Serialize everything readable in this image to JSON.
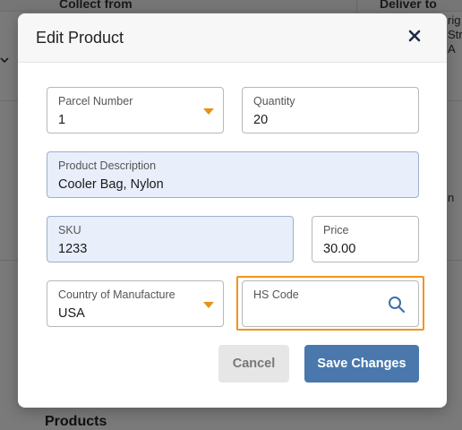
{
  "background": {
    "column_left": "Collect from",
    "column_right": "Deliver to",
    "cell_fragments": [
      "rig",
      "Str",
      "A"
    ],
    "cell_fragment_2": "n",
    "section_title": "Products"
  },
  "modal": {
    "title": "Edit Product",
    "close_icon": "close-icon",
    "fields": {
      "parcel_number": {
        "label": "Parcel Number",
        "value": "1"
      },
      "quantity": {
        "label": "Quantity",
        "value": "20"
      },
      "product_description": {
        "label": "Product Description",
        "value": "Cooler Bag, Nylon"
      },
      "sku": {
        "label": "SKU",
        "value": "1233"
      },
      "price": {
        "label": "Price",
        "value": "30.00"
      },
      "country_of_manufacture": {
        "label": "Country of Manufacture",
        "value": "USA"
      },
      "hs_code": {
        "label": "HS Code",
        "value": "",
        "icon": "search-icon"
      }
    },
    "buttons": {
      "cancel_label": "Cancel",
      "save_label": "Save Changes"
    }
  },
  "colors": {
    "accent_orange": "#f0941e",
    "primary_button": "#4a78ad",
    "filled_field": "#e8eefa"
  }
}
